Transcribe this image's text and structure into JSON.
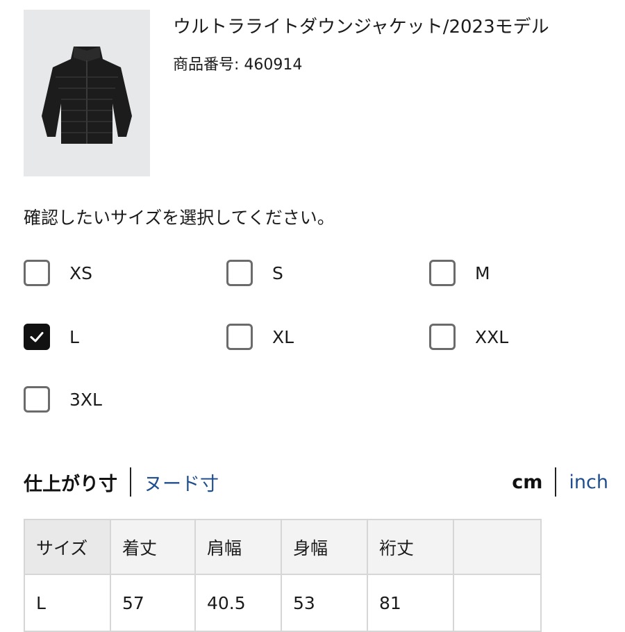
{
  "product": {
    "name": "ウルトラライトダウンジャケット/2023モデル",
    "number": "商品番号: 460914",
    "image_icon": "down-jacket-image"
  },
  "prompt": "確認したいサイズを選択してください。",
  "sizes": [
    {
      "label": "XS",
      "checked": false
    },
    {
      "label": "S",
      "checked": false
    },
    {
      "label": "M",
      "checked": false
    },
    {
      "label": "L",
      "checked": true
    },
    {
      "label": "XL",
      "checked": false
    },
    {
      "label": "XXL",
      "checked": false
    },
    {
      "label": "3XL",
      "checked": false
    }
  ],
  "measure_tabs": {
    "active": "仕上がり寸",
    "other": "ヌード寸"
  },
  "units": {
    "active": "cm",
    "other": "inch"
  },
  "table": {
    "headers": [
      "サイズ",
      "着丈",
      "肩幅",
      "身幅",
      "裄丈",
      ""
    ],
    "rows": [
      [
        "L",
        "57",
        "40.5",
        "53",
        "81",
        ""
      ]
    ]
  },
  "colors": {
    "link": "#1f4e8f",
    "checked_box": "#111111",
    "thumb_bg": "#e6e8e9"
  }
}
